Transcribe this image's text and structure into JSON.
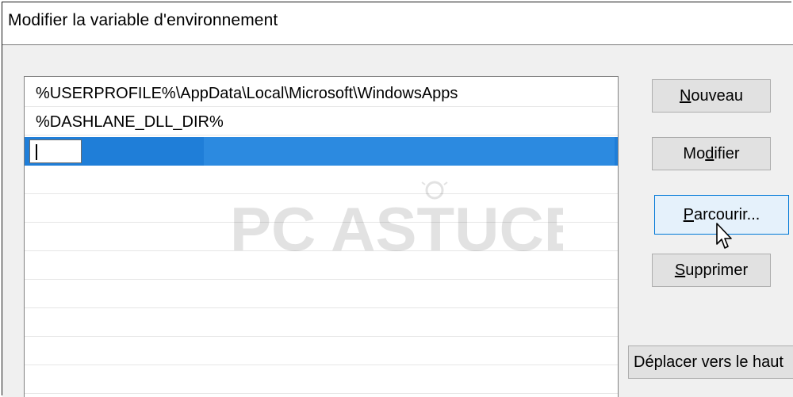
{
  "window": {
    "title": "Modifier la variable d'environnement"
  },
  "list": {
    "items": [
      "%USERPROFILE%\\AppData\\Local\\Microsoft\\WindowsApps",
      "%DASHLANE_DLL_DIR%"
    ],
    "editing_value": ""
  },
  "buttons": {
    "nouveau": {
      "mnemonic": "N",
      "rest": "ouveau"
    },
    "modifier": {
      "pre": "Mo",
      "mnemonic": "d",
      "rest": "ifier"
    },
    "parcourir": {
      "mnemonic": "P",
      "rest": "arcourir..."
    },
    "supprimer": {
      "mnemonic": "S",
      "rest": "upprimer"
    },
    "deplacer_haut": "Déplacer vers le haut"
  },
  "watermark": {
    "text": "PC ASTUCES"
  },
  "colors": {
    "selection": "#1f7ed8",
    "selection_light": "#2c8ae0",
    "button_face": "#e1e1e1",
    "button_hover": "#e5f1fb",
    "button_hover_border": "#0078d7"
  }
}
